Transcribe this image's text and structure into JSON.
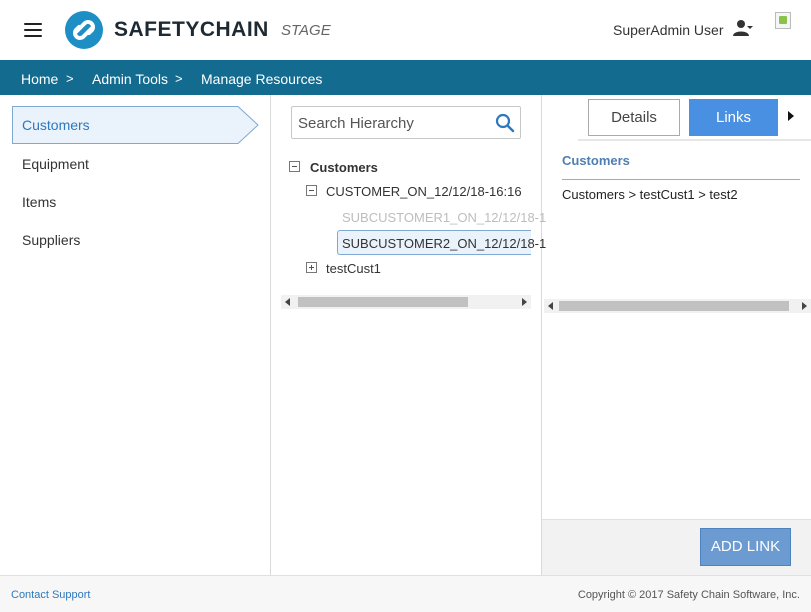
{
  "header": {
    "brand": "SAFETYCHAIN",
    "environment": "STAGE",
    "user_name": "SuperAdmin User",
    "menu_icon": "hamburger-menu-icon",
    "user_icon": "user-settings-icon",
    "logo_color": "#1e8fc4"
  },
  "breadcrumb": {
    "items": [
      "Home",
      "Admin Tools",
      "Manage Resources"
    ],
    "separator": ">",
    "background": "#136b8f"
  },
  "sidebar": {
    "items": [
      {
        "label": "Customers",
        "active": true
      },
      {
        "label": "Equipment",
        "active": false
      },
      {
        "label": "Items",
        "active": false
      },
      {
        "label": "Suppliers",
        "active": false
      }
    ]
  },
  "hierarchy": {
    "search_placeholder": "Search Hierarchy",
    "search_icon": "search-icon",
    "root": "Customers",
    "nodes": [
      {
        "label": "CUSTOMER_ON_12/12/18-16:16",
        "expanded": true
      },
      {
        "label": "SUBCUSTOMER1_ON_12/12/18-1",
        "disabled": true
      },
      {
        "label": "SUBCUSTOMER2_ON_12/12/18-1",
        "selected": true
      },
      {
        "label": "testCust1",
        "expanded": false
      }
    ]
  },
  "details_panel": {
    "tabs": [
      {
        "label": "Details",
        "active": false
      },
      {
        "label": "Links",
        "active": true
      }
    ],
    "section_title": "Customers",
    "link_path": "Customers > testCust1 > test2",
    "add_button": "ADD LINK",
    "accent": "#4a90e2"
  },
  "footer": {
    "contact": "Contact Support",
    "copyright": "Copyright © 2017 Safety Chain Software, Inc."
  }
}
